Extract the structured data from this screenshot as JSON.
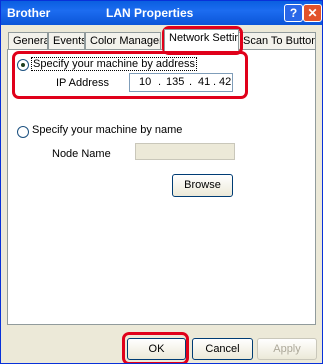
{
  "window": {
    "app_name": "Brother",
    "title": "LAN Properties",
    "help_glyph": "?",
    "close_glyph": "✕"
  },
  "tabs": [
    {
      "label": "General"
    },
    {
      "label": "Events"
    },
    {
      "label": "Color Management"
    },
    {
      "label": "Network Setting"
    },
    {
      "label": "Scan To Button"
    }
  ],
  "network": {
    "by_address_label": "Specify your machine by address",
    "ip_label": "IP Address",
    "ip": [
      "10",
      "135",
      "41",
      "42"
    ],
    "ip_separator": ".",
    "by_name_label": "Specify your machine by name",
    "node_name_label": "Node Name",
    "node_name_value": "",
    "browse_label": "Browse"
  },
  "footer": {
    "ok_label": "OK",
    "cancel_label": "Cancel",
    "apply_label": "Apply"
  },
  "colors": {
    "highlight": "#e0001a",
    "title_bar": "#0a5fe0",
    "face": "#ece9d8"
  }
}
